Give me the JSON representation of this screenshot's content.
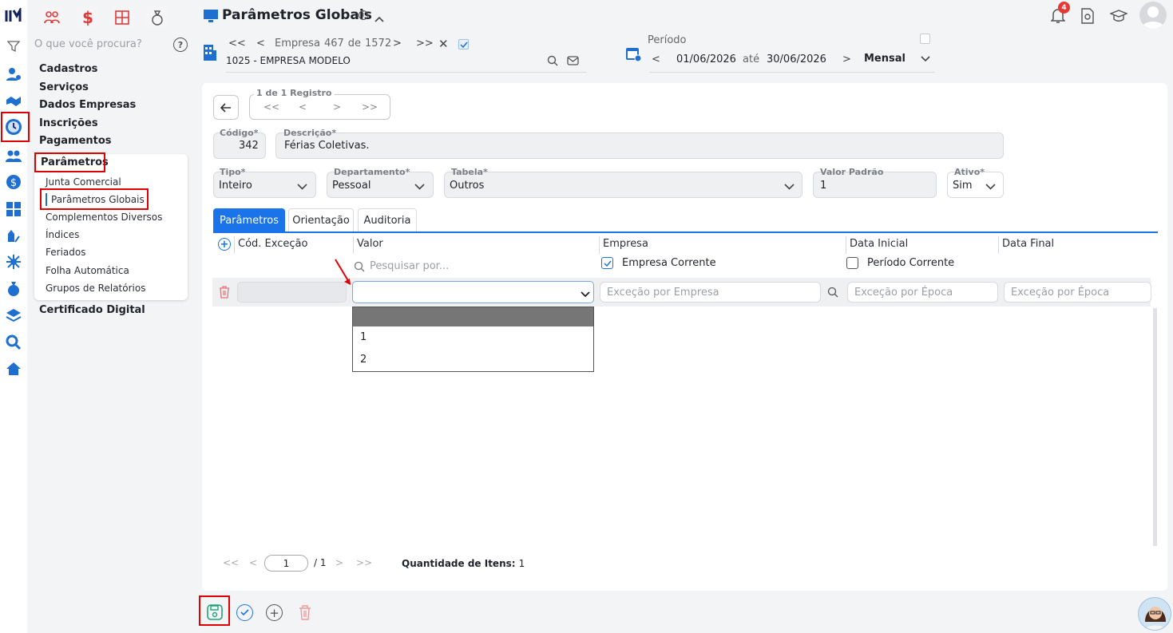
{
  "header": {
    "title": "Parâmetros Globais",
    "notification_count": "4"
  },
  "search": {
    "placeholder": "O que você procura?"
  },
  "nav": {
    "sections": [
      "Cadastros",
      "Serviços",
      "Dados Empresas",
      "Inscrições",
      "Pagamentos"
    ],
    "active_section": "Parâmetros",
    "subitems": [
      "Junta Comercial",
      "Parâmetros Globais",
      "Complementos Diversos",
      "Índices",
      "Feriados",
      "Folha Automática",
      "Grupos de Relatórios"
    ],
    "after": "Certificado Digital"
  },
  "company": {
    "pager_label": "Empresa",
    "position": "467",
    "of": "de",
    "total": "1572",
    "name": "1025 - EMPRESA MODELO"
  },
  "period": {
    "label": "Período",
    "start": "01/06/2026",
    "until": "até",
    "end": "30/06/2026",
    "mode": "Mensal"
  },
  "record": {
    "pager": "1 de 1 Registro",
    "codigo_label": "Código*",
    "codigo": "342",
    "descricao_label": "Descrição*",
    "descricao": "Férias Coletivas.",
    "tipo_label": "Tipo*",
    "tipo": "Inteiro",
    "departamento_label": "Departamento*",
    "departamento": "Pessoal",
    "tabela_label": "Tabela*",
    "tabela": "Outros",
    "valor_padrao_label": "Valor Padrão",
    "valor_padrao": "1",
    "ativo_label": "Ativo*",
    "ativo": "Sim"
  },
  "tabs": [
    "Parâmetros",
    "Orientação",
    "Auditoria"
  ],
  "grid": {
    "columns": [
      "Cód. Exceção",
      "Valor",
      "Empresa",
      "Data Inicial",
      "Data Final"
    ],
    "search_placeholder": "Pesquisar por...",
    "empresa_corrente": "Empresa Corrente",
    "periodo_corrente": "Período Corrente",
    "excecao_empresa_placeholder": "Exceção por Empresa",
    "excecao_epoca_placeholder": "Exceção por Época",
    "dropdown_options": [
      "",
      "1",
      "2"
    ]
  },
  "footer": {
    "page": "1",
    "pages": "/ 1",
    "qty_label": "Quantidade de Itens:",
    "qty": "1"
  },
  "colors": {
    "accent": "#1a73e8",
    "danger": "#e53935",
    "highlight": "#e00000"
  }
}
